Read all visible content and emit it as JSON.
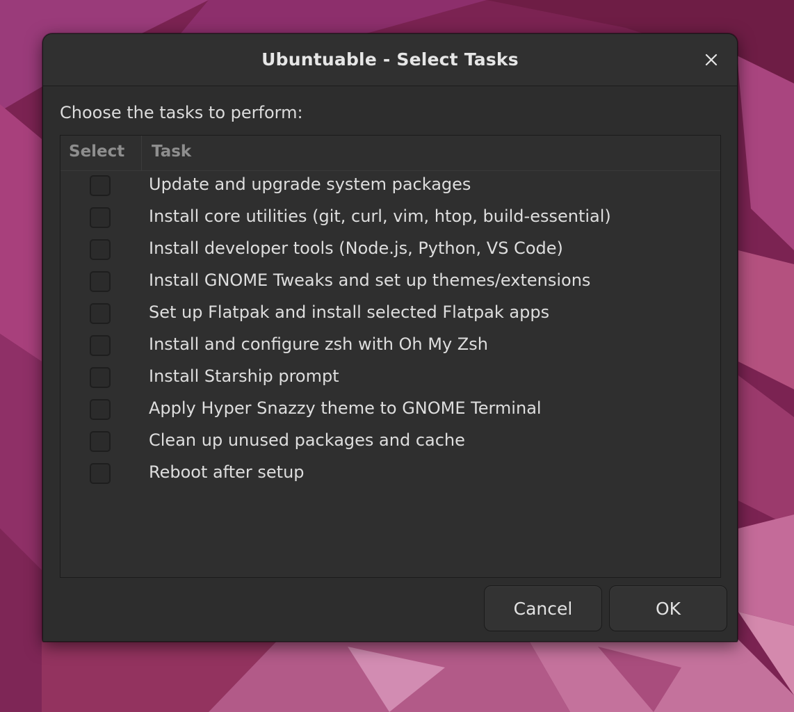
{
  "window": {
    "title": "Ubuntuable - Select Tasks",
    "close_icon": "close-icon"
  },
  "prompt": "Choose the tasks to perform:",
  "table": {
    "columns": [
      "Select",
      "Task"
    ],
    "rows": [
      {
        "selected": false,
        "task": "Update and upgrade system packages"
      },
      {
        "selected": false,
        "task": "Install core utilities (git, curl, vim, htop, build-essential)"
      },
      {
        "selected": false,
        "task": "Install developer tools (Node.js, Python, VS Code)"
      },
      {
        "selected": false,
        "task": "Install GNOME Tweaks and set up themes/extensions"
      },
      {
        "selected": false,
        "task": "Set up Flatpak and install selected Flatpak apps"
      },
      {
        "selected": false,
        "task": "Install and configure zsh with Oh My Zsh"
      },
      {
        "selected": false,
        "task": "Install Starship prompt"
      },
      {
        "selected": false,
        "task": "Apply Hyper Snazzy theme to GNOME Terminal"
      },
      {
        "selected": false,
        "task": "Clean up unused packages and cache"
      },
      {
        "selected": false,
        "task": "Reboot after setup"
      }
    ]
  },
  "buttons": {
    "cancel": "Cancel",
    "ok": "OK"
  },
  "colors": {
    "desktop_background": "#7a2350",
    "dialog_background": "#2d2d2d",
    "text": "#dedede",
    "header_text": "#8e8e8e"
  }
}
